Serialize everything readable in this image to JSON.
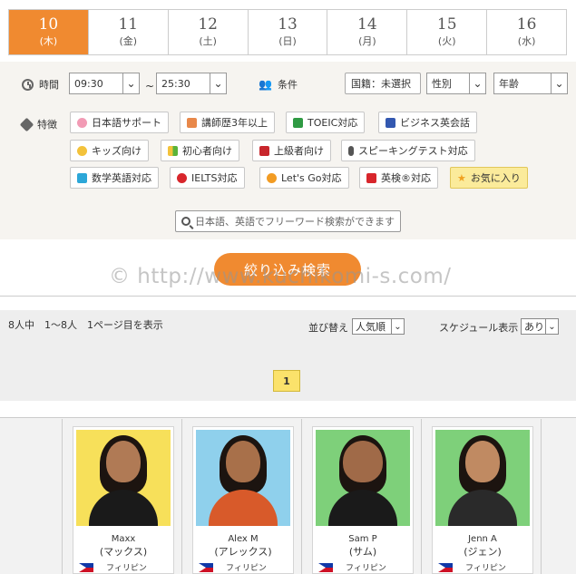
{
  "dates": [
    {
      "day": "10",
      "dow": "(木)",
      "active": true
    },
    {
      "day": "11",
      "dow": "(金)"
    },
    {
      "day": "12",
      "dow": "(土)"
    },
    {
      "day": "13",
      "dow": "(日)"
    },
    {
      "day": "14",
      "dow": "(月)"
    },
    {
      "day": "15",
      "dow": "(火)"
    },
    {
      "day": "16",
      "dow": "(水)"
    }
  ],
  "filters": {
    "time_label": "時間",
    "time_from": "09:30",
    "time_sep": "~",
    "time_to": "25:30",
    "cond_label": "条件",
    "nationality": "国籍：未選択",
    "gender": "性別",
    "age": "年齢",
    "feature_label": "特徴",
    "features": [
      {
        "label": "日本語サポート",
        "color": "#f29bb5"
      },
      {
        "label": "講師歴3年以上",
        "color": "#e8884a"
      },
      {
        "label": "TOEIC対応",
        "color": "#2f9a43"
      },
      {
        "label": "ビジネス英会話",
        "color": "#3358b0"
      },
      {
        "label": "キッズ向け",
        "color": "#f3c23b"
      },
      {
        "label": "初心者向け",
        "color": "#5ab33a"
      },
      {
        "label": "上級者向け",
        "color": "#c8262c"
      },
      {
        "label": "スピーキングテスト対応",
        "color": "#555555"
      },
      {
        "label": "数学英語対応",
        "color": "#2ca7d8"
      },
      {
        "label": "IELTS対応",
        "color": "#d8262c"
      },
      {
        "label": "Let's Go対応",
        "color": "#f29c24"
      },
      {
        "label": "英検®対応",
        "color": "#d8262c"
      },
      {
        "label": "お気に入り",
        "color": "#f0a020"
      }
    ],
    "search_placeholder": "日本語、英語でフリーワード検索ができます",
    "search_button": "絞り込み検索"
  },
  "watermark": "© http://www.kuchikomi-s.com/",
  "results": {
    "count_text": "8人中　1〜8人　1ページ目を表示",
    "sort_label": "並び替え",
    "sort_value": "人気順",
    "schedule_label": "スケジュール表示",
    "schedule_value": "あり",
    "page": "1"
  },
  "teachers": [
    {
      "name": "Maxx",
      "kana": "(マックス)",
      "country": "フィリピン",
      "bg": "#f7e05a",
      "shirt": "#1a1a1a"
    },
    {
      "name": "Alex M",
      "kana": "(アレックス)",
      "country": "フィリピン",
      "bg": "#8fd0ec",
      "shirt": "#d85a2a"
    },
    {
      "name": "Sam P",
      "kana": "(サム)",
      "country": "フィリピン",
      "bg": "#7ed07a",
      "shirt": "#1a1a1a"
    },
    {
      "name": "Jenn A",
      "kana": "(ジェン)",
      "country": "フィリピン",
      "bg": "#7ed07a",
      "shirt": "#2a2a2a"
    }
  ]
}
